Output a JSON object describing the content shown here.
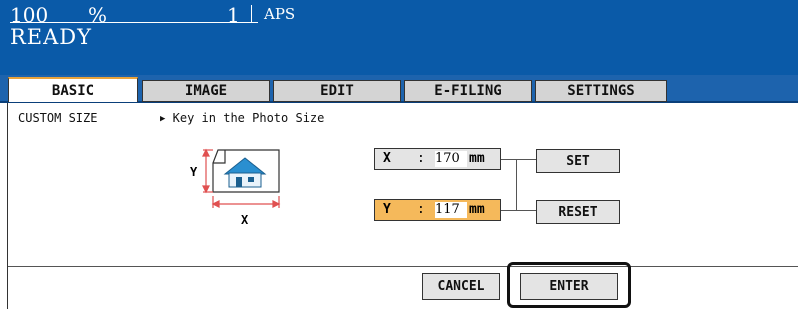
{
  "header": {
    "zoom": "100",
    "zoom_unit": "%",
    "copies": "1",
    "paper": "APS",
    "status": "READY"
  },
  "tabs": [
    {
      "label": "BASIC",
      "active": true
    },
    {
      "label": "IMAGE",
      "active": false
    },
    {
      "label": "EDIT",
      "active": false
    },
    {
      "label": "E-FILING",
      "active": false
    },
    {
      "label": "SETTINGS",
      "active": false
    }
  ],
  "content": {
    "mode_label": "CUSTOM SIZE",
    "instruction": "Key in the Photo Size",
    "diagram": {
      "y_label": "Y",
      "x_label": "X",
      "icon": "photo-house-icon"
    },
    "fields": {
      "x": {
        "label": "X",
        "colon": ":",
        "value": "170",
        "unit": "mm"
      },
      "y": {
        "label": "Y",
        "colon": ":",
        "value": "117",
        "unit": "mm"
      }
    },
    "buttons": {
      "set": "SET",
      "reset": "RESET",
      "cancel": "CANCEL",
      "enter": "ENTER"
    }
  },
  "colors": {
    "header": "#0a5aa8",
    "active_field": "#f5b95b",
    "accent_tab": "#e8a33c",
    "arrow": "#e05050"
  }
}
